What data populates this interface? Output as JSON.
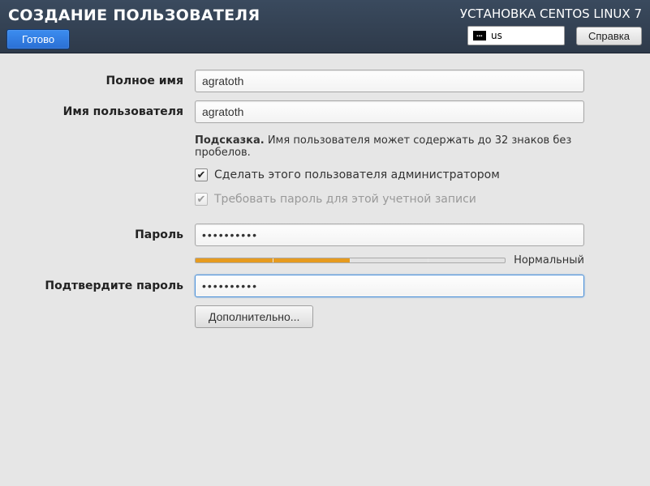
{
  "header": {
    "title": "СОЗДАНИЕ ПОЛЬЗОВАТЕЛЯ",
    "done_label": "Готово",
    "install_title": "УСТАНОВКА CENTOS LINUX 7",
    "keyboard_layout": "us",
    "help_label": "Справка"
  },
  "form": {
    "fullname_label": "Полное имя",
    "fullname_value": "agratoth",
    "username_label": "Имя пользователя",
    "username_value": "agratoth",
    "hint_bold": "Подсказка.",
    "hint_text": " Имя пользователя может содержать до 32 знаков без пробелов.",
    "admin_checkbox_label": "Сделать этого пользователя администратором",
    "admin_checked": true,
    "require_pw_label": "Требовать пароль для этой учетной записи",
    "require_pw_checked": true,
    "password_label": "Пароль",
    "password_value": "••••••••••",
    "strength_label": "Нормальный",
    "confirm_label": "Подтвердите пароль",
    "confirm_value": "••••••••••",
    "advanced_label": "Дополнительно..."
  }
}
